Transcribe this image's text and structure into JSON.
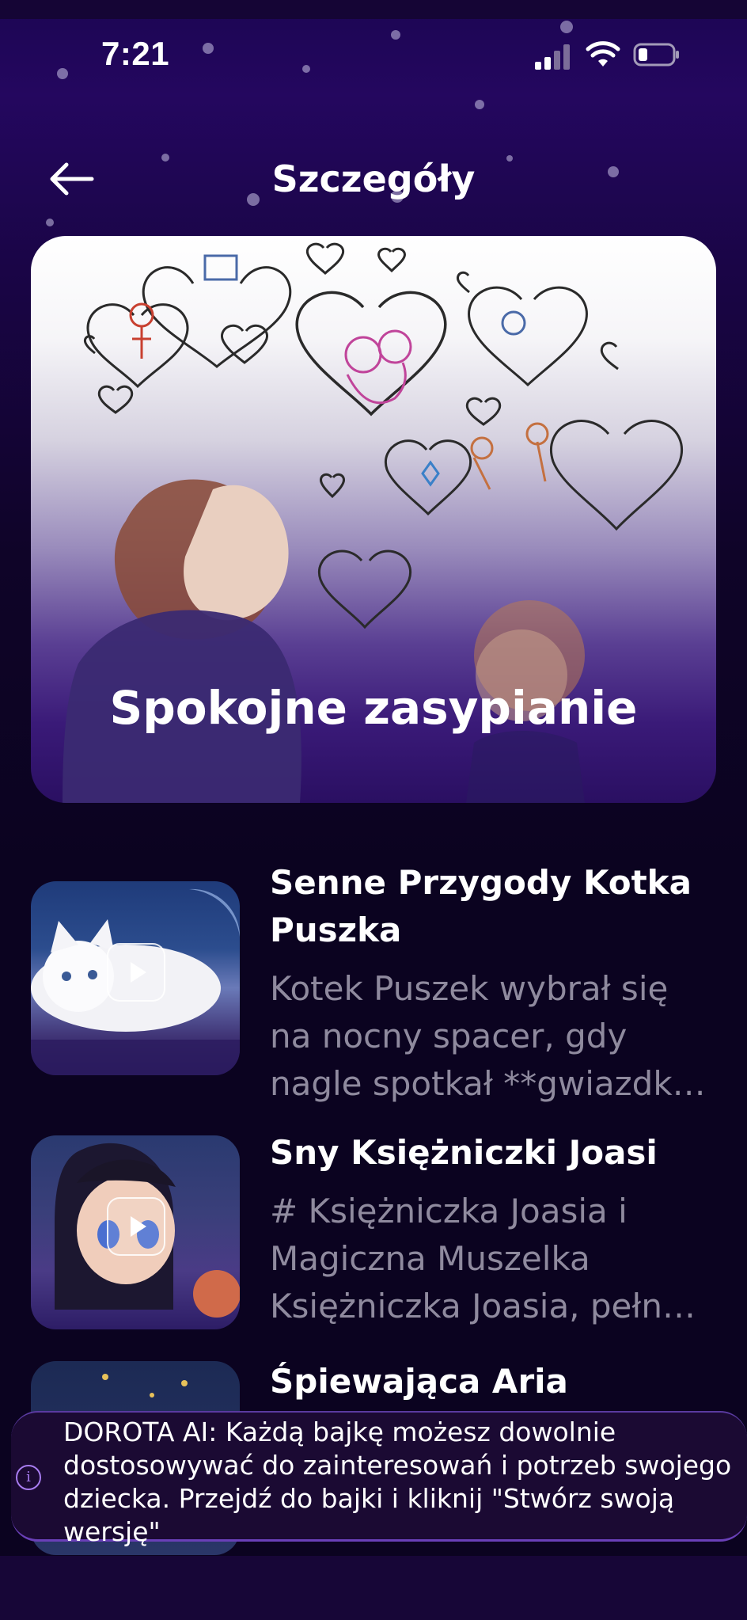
{
  "status_bar": {
    "time": "7:21"
  },
  "header": {
    "title": "Szczegóły",
    "back_icon": "arrow-left-icon"
  },
  "hero": {
    "title": "Spokojne zasypianie"
  },
  "stories": [
    {
      "title": "Senne Przygody Kotka Puszka",
      "description": "Kotek Puszek wybrał się na nocny spacer, gdy nagle spotkał **gwiazdk…"
    },
    {
      "title": "Sny Księżniczki Joasi",
      "description": "# Księżniczka Joasia i Magiczna Muszelka Księżniczka Joasia, pełn…"
    },
    {
      "title": "Śpiewająca Aria",
      "description": ""
    }
  ],
  "info_toast": {
    "icon": "info-icon",
    "text": "DOROTA AI: Każdą bajkę możesz dowolnie dostosowywać do zainteresowań i potrzeb swojego dziecka. Przejdź do bajki i kliknij \"Stwórz swoją wersję\""
  },
  "colors": {
    "background": "#0b0320",
    "accent": "#a77cf0",
    "muted_text": "#8f8a9e"
  }
}
